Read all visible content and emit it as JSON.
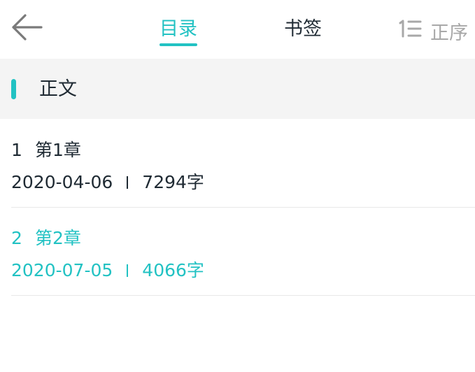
{
  "header": {
    "tabs": [
      {
        "label": "目录",
        "active": true
      },
      {
        "label": "书签",
        "active": false
      }
    ],
    "sort_label": "正序"
  },
  "section": {
    "title": "正文"
  },
  "chapters": [
    {
      "number": "1",
      "title": "第1章",
      "date": "2020-04-06",
      "words": "7294字",
      "current": false
    },
    {
      "number": "2",
      "title": "第2章",
      "date": "2020-07-05",
      "words": "4066字",
      "current": true
    }
  ],
  "colors": {
    "accent": "#22c2c3",
    "text": "#1f2a33",
    "muted": "#a8a8a8",
    "section_bg": "#f4f4f4",
    "divider": "#e8e8e8"
  },
  "icons": {
    "back": "arrow-left-icon",
    "sort": "sort-order-icon"
  }
}
